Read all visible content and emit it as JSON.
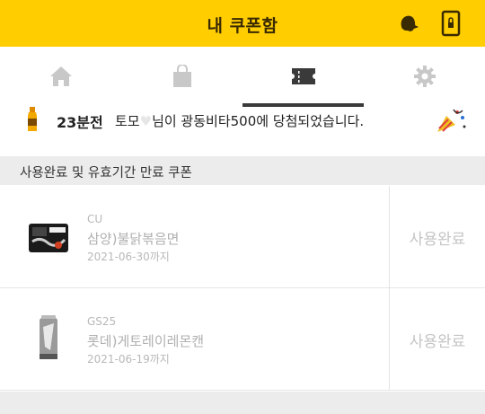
{
  "header": {
    "title": "내 쿠폰함",
    "icons": [
      "bell-icon",
      "phone-lock-icon"
    ],
    "background": "#ffcd00"
  },
  "tabs": [
    {
      "icon": "home-icon",
      "active": false
    },
    {
      "icon": "shopping-bag-icon",
      "active": false
    },
    {
      "icon": "ticket-icon",
      "active": true
    },
    {
      "icon": "gear-icon",
      "active": false
    }
  ],
  "ticker": {
    "time": "23분전",
    "text_before": "토모",
    "text_after": "님이 광동비타500에 당첨되었습니다."
  },
  "section": {
    "title": "사용완료 및 유효기간 만료 쿠폰"
  },
  "coupons": [
    {
      "brand": "CU",
      "name": "삼양)불닭볶음면",
      "expiry": "2021-06-30까지",
      "status": "사용완료",
      "image": "noodle-pack-image"
    },
    {
      "brand": "GS25",
      "name": "롯데)게토레이레몬캔",
      "expiry": "2021-06-19까지",
      "status": "사용완료",
      "image": "can-image"
    }
  ]
}
